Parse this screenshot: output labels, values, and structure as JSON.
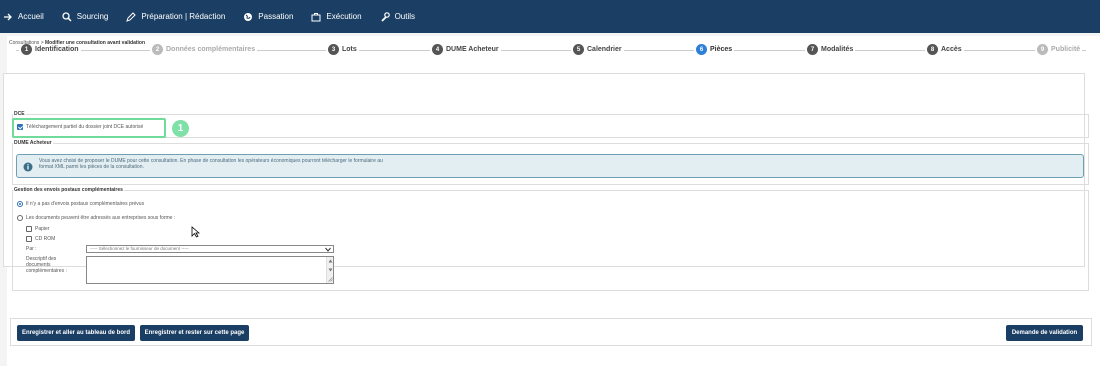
{
  "nav": [
    {
      "label": "Accueil",
      "icon": "arrow-icon"
    },
    {
      "label": "Sourcing",
      "icon": "search-icon"
    },
    {
      "label": "Préparation | Rédaction",
      "icon": "pencil-icon"
    },
    {
      "label": "Passation",
      "icon": "globe-icon"
    },
    {
      "label": "Exécution",
      "icon": "briefcase-icon"
    },
    {
      "label": "Outils",
      "icon": "wrench-icon"
    }
  ],
  "breadcrumb": {
    "root": "Consultations",
    "current": "Modifier une consultation avant validation"
  },
  "steps": [
    {
      "num": "1",
      "label": "Identification",
      "state": "done"
    },
    {
      "num": "2",
      "label": "Données complémentaires",
      "state": "disabled"
    },
    {
      "num": "3",
      "label": "Lots",
      "state": "done"
    },
    {
      "num": "4",
      "label": "DUME Acheteur",
      "state": "done"
    },
    {
      "num": "5",
      "label": "Calendrier",
      "state": "done"
    },
    {
      "num": "6",
      "label": "Pièces",
      "state": "active"
    },
    {
      "num": "7",
      "label": "Modalités",
      "state": "done"
    },
    {
      "num": "8",
      "label": "Accès",
      "state": "done"
    },
    {
      "num": "9",
      "label": "Publicité",
      "state": "disabled"
    }
  ],
  "dce": {
    "legend": "DCE",
    "checkbox_label": "Téléchargement partiel du dossier joint DCE autorisé",
    "checked": true,
    "callout_number": "1"
  },
  "dume": {
    "legend": "DUME Acheteur",
    "info_text": "Vous avez choisi de proposer le DUME pour cette consultation. En phase de consultation les opérateurs économiques pourront télécharger le formulaire au format XML parmi les pièces de la consultation."
  },
  "envois": {
    "legend": "Gestion des envois postaux complémentaires",
    "radio1": "Il n'y a pas d'envois postaux complémentaires prévus",
    "radio2": "Les documents peuvent être adressés aux entreprises sous forme :",
    "opt_papier": "Papier",
    "opt_cdrom": "CD ROM",
    "par_label": "Par :",
    "select_value": "----- Sélectionnez le fournisseur de document -----",
    "descriptif_label": "Descriptif des documents complémentaires :"
  },
  "buttons": {
    "save_dashboard": "Enregistrer et aller au tableau de bord",
    "save_stay": "Enregistrer et rester sur cette page",
    "request_validation": "Demande de validation"
  }
}
